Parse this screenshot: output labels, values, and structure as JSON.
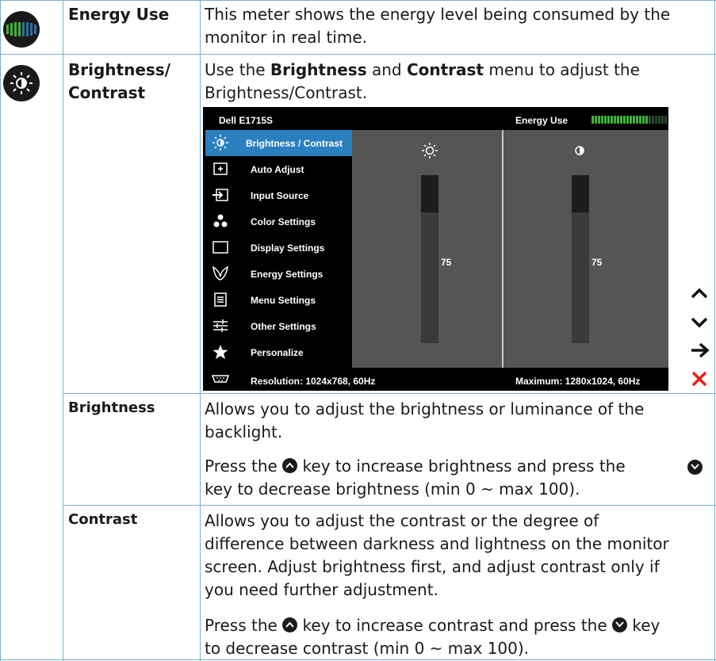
{
  "rows": {
    "energy": {
      "name": "Energy Use",
      "description": "This meter shows the energy level being consumed by the monitor in real time."
    },
    "brightness_contrast": {
      "name_line1": "Brightness/",
      "name_line2": "Contrast",
      "desc_part1": "Use the ",
      "desc_bold1": "Brightness",
      "desc_part2": " and ",
      "desc_bold2": "Contrast",
      "desc_part3": " menu to adjust the",
      "desc_line2": "Brightness/Contrast."
    },
    "brightness": {
      "name": "Brightness",
      "desc_line1": "Allows you to adjust the brightness or luminance of the",
      "desc_line2": "backlight.",
      "press_a": "Press the",
      "press_b": "key to increase brightness and press the",
      "press_c": "key to decrease brightness (min 0 ~ max 100)."
    },
    "contrast": {
      "name": "Contrast",
      "desc_line1": "Allows you to adjust the contrast or the degree of",
      "desc_line2": "difference between darkness and lightness on the monitor",
      "desc_line3": "screen. Adjust brightness first, and adjust contrast only if",
      "desc_line4": "you need further adjustment.",
      "press_a": "Press the",
      "press_b": "key to increase contrast and press the",
      "press_c": "key",
      "press_d": "to decrease contrast (min 0 ~ max 100)."
    }
  },
  "osd": {
    "model": "Dell E1715S",
    "energy_label": "Energy Use",
    "energy_level": 0.75,
    "menu": [
      {
        "label": "Brightness / Contrast",
        "icon": "sun-icon",
        "active": true
      },
      {
        "label": "Auto Adjust",
        "icon": "auto-adjust-icon",
        "active": false
      },
      {
        "label": "Input Source",
        "icon": "input-source-icon",
        "active": false
      },
      {
        "label": "Color Settings",
        "icon": "color-dots-icon",
        "active": false
      },
      {
        "label": "Display Settings",
        "icon": "display-rect-icon",
        "active": false
      },
      {
        "label": "Energy Settings",
        "icon": "leaf-icon",
        "active": false
      },
      {
        "label": "Menu Settings",
        "icon": "menu-doc-icon",
        "active": false
      },
      {
        "label": "Other Settings",
        "icon": "sliders-icon",
        "active": false
      },
      {
        "label": "Personalize",
        "icon": "star-icon",
        "active": false
      }
    ],
    "brightness_value": "75",
    "contrast_value": "75",
    "brightness_level": 0.75,
    "contrast_level": 0.75,
    "resolution": "Resolution: 1024x768, 60Hz",
    "maximum": "Maximum: 1280x1024, 60Hz"
  },
  "colors": {
    "grid": "#7ab0c9",
    "osd_active": "#2a7fbe",
    "energy_green": "#3fb23a",
    "close_red": "#e8201a"
  }
}
